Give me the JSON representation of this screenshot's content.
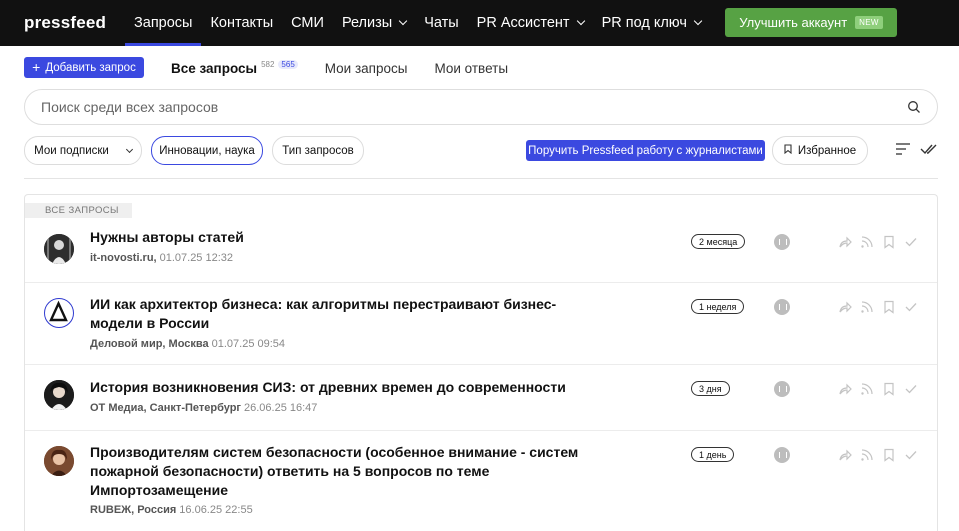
{
  "header": {
    "logo": "pressfeed",
    "nav": [
      {
        "label": "Запросы",
        "active": true,
        "dropdown": false
      },
      {
        "label": "Контакты",
        "active": false,
        "dropdown": false
      },
      {
        "label": "СМИ",
        "active": false,
        "dropdown": false
      },
      {
        "label": "Релизы",
        "active": false,
        "dropdown": true
      },
      {
        "label": "Чаты",
        "active": false,
        "dropdown": false
      },
      {
        "label": "PR Ассистент",
        "active": false,
        "dropdown": true
      },
      {
        "label": "PR под ключ",
        "active": false,
        "dropdown": true
      }
    ],
    "upgrade_label": "Улучшить аккаунт",
    "upgrade_badge": "NEW"
  },
  "toolbar": {
    "add_label": "Добавить запрос",
    "tabs": [
      {
        "label": "Все запросы",
        "count": "582",
        "count2": "565",
        "active": true
      },
      {
        "label": "Мои запросы",
        "active": false
      },
      {
        "label": "Мои ответы",
        "active": false
      }
    ]
  },
  "search": {
    "placeholder": "Поиск среди всех запросов",
    "value": ""
  },
  "filters": {
    "subscriptions_label": "Мои подписки",
    "category_label": "Инновации, наука",
    "type_label": "Тип запросов",
    "promo_label": "Поручить Pressfeed работу с журналистами",
    "favorites_label": "Избранное"
  },
  "list": {
    "section_label": "ВСЕ ЗАПРОСЫ",
    "rows": [
      {
        "title": "Нужны авторы статей",
        "source": "it-novosti.ru,",
        "date": "01.07.25 12:32",
        "age": "2 месяца",
        "avatar": "photo-bw"
      },
      {
        "title": "ИИ как архитектор бизнеса: как алгоритмы перестраивают бизнес-модели в России",
        "source": "Деловой мир, Москва",
        "date": "01.07.25 09:54",
        "age": "1 неделя",
        "avatar": "delta-logo"
      },
      {
        "title": "История возникновения СИЗ: от древних времен до современности",
        "source": "ОТ Медиа, Санкт-Петербург",
        "date": "26.06.25 16:47",
        "age": "3 дня",
        "avatar": "photo-woman"
      },
      {
        "title": "Производителям систем безопасности (особенное внимание - систем пожарной безопасности) ответить на 5 вопросов по теме Импортозамещение",
        "source": "RUBEЖ, Россия",
        "date": "16.06.25 22:55",
        "age": "1 день",
        "avatar": "photo-woman-2"
      }
    ]
  },
  "colors": {
    "accent": "#3b49e0",
    "upgrade": "#57a244",
    "topbar": "#111111"
  }
}
